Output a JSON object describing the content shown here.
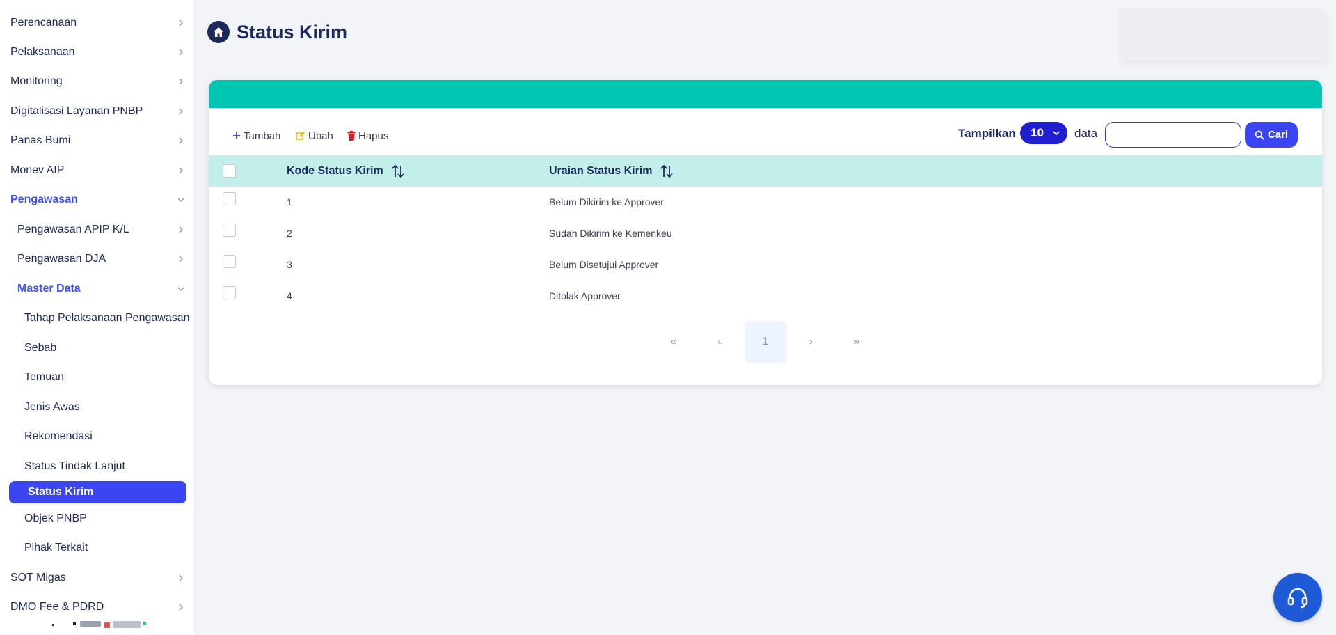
{
  "sidebar": {
    "items": [
      {
        "label": "Perencanaan"
      },
      {
        "label": "Pelaksanaan"
      },
      {
        "label": "Monitoring"
      },
      {
        "label": "Digitalisasi Layanan PNBP"
      },
      {
        "label": "Panas Bumi"
      },
      {
        "label": "Monev AIP"
      },
      {
        "label": "Pengawasan"
      },
      {
        "label": "Pengawasan APIP K/L"
      },
      {
        "label": "Pengawasan DJA"
      },
      {
        "label": "Master Data"
      },
      {
        "label": "Tahap Pelaksanaan Pengawasan"
      },
      {
        "label": "Sebab"
      },
      {
        "label": "Temuan"
      },
      {
        "label": "Jenis Awas"
      },
      {
        "label": "Rekomendasi"
      },
      {
        "label": "Status Tindak Lanjut"
      },
      {
        "label": "Status Kirim"
      },
      {
        "label": "Objek PNBP"
      },
      {
        "label": "Pihak Terkait"
      },
      {
        "label": "SOT Migas"
      },
      {
        "label": "DMO Fee & PDRD"
      }
    ]
  },
  "header": {
    "title": "Status Kirim",
    "icon": "home-icon"
  },
  "toolbar": {
    "add_label": "Tambah",
    "edit_label": "Ubah",
    "delete_label": "Hapus"
  },
  "filter": {
    "show_label": "Tampilkan",
    "page_size": "10",
    "data_label": "data",
    "search_value": "",
    "search_button": "Cari"
  },
  "table": {
    "columns": [
      "Kode Status Kirim",
      "Uraian Status Kirim"
    ],
    "rows": [
      [
        "1",
        "Belum Dikirim ke Approver"
      ],
      [
        "2",
        "Sudah Dikirim ke Kemenkeu"
      ],
      [
        "3",
        "Belum Disetujui Approver"
      ],
      [
        "4",
        "Ditolak Approver"
      ]
    ]
  },
  "pagination": {
    "first": "«",
    "prev": "‹",
    "current": "1",
    "next": "›",
    "last": "»"
  },
  "colors": {
    "accent": "#3b45f2",
    "band": "#00c5b0",
    "header_bg": "#c2efe9",
    "navy": "#1c2a5b"
  }
}
